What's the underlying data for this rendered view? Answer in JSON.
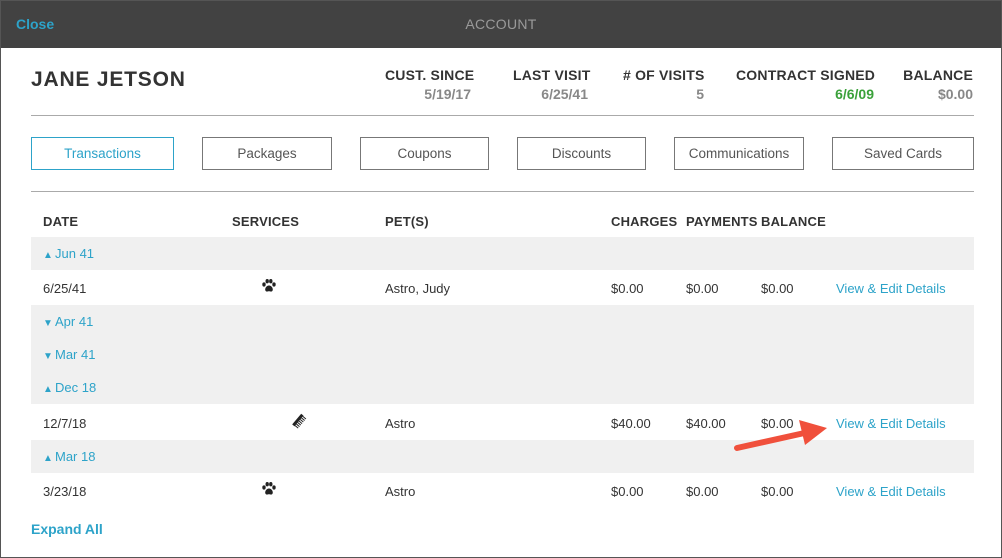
{
  "topbar": {
    "close_label": "Close",
    "title": "ACCOUNT"
  },
  "customer": {
    "name": "JANE JETSON",
    "stats": [
      {
        "label": "CUST. SINCE",
        "value": "5/19/17"
      },
      {
        "label": "LAST VISIT",
        "value": "6/25/41"
      },
      {
        "label": "# OF VISITS",
        "value": "5"
      },
      {
        "label": "CONTRACT SIGNED",
        "value": "6/6/09"
      },
      {
        "label": "BALANCE",
        "value": "$0.00"
      }
    ]
  },
  "tabs": [
    {
      "label": "Transactions",
      "active": true
    },
    {
      "label": "Packages"
    },
    {
      "label": "Coupons"
    },
    {
      "label": "Discounts"
    },
    {
      "label": "Communications"
    },
    {
      "label": "Saved Cards"
    }
  ],
  "table": {
    "headers": {
      "date": "DATE",
      "services": "SERVICES",
      "pets": "PET(S)",
      "charges": "CHARGES",
      "payments": "PAYMENTS",
      "balance": "BALANCE"
    },
    "groups": [
      {
        "label": "Jun 41",
        "chevron": "up"
      },
      {
        "label": "Apr 41",
        "chevron": "down"
      },
      {
        "label": "Mar 41",
        "chevron": "down"
      },
      {
        "label": "Dec 18",
        "chevron": "up"
      },
      {
        "label": "Mar 18",
        "chevron": "up"
      }
    ],
    "rows": [
      {
        "date": "6/25/41",
        "service_icon": "paw-icon",
        "pets": "Astro, Judy",
        "charges": "$0.00",
        "payments": "$0.00",
        "balance": "$0.00",
        "action": "View & Edit Details"
      },
      {
        "date": "12/7/18",
        "service_icon": "comb-icon",
        "pets": "Astro",
        "charges": "$40.00",
        "payments": "$40.00",
        "balance": "$0.00",
        "action": "View & Edit Details"
      },
      {
        "date": "3/23/18",
        "service_icon": "paw-icon",
        "pets": "Astro",
        "charges": "$0.00",
        "payments": "$0.00",
        "balance": "$0.00",
        "action": "View & Edit Details"
      }
    ]
  },
  "footer": {
    "expand_all_label": "Expand All"
  },
  "colors": {
    "accent": "#2da3c9",
    "topbar": "#424242",
    "group_bg": "#f0f0f0",
    "contract_green": "#3aa13a",
    "annotation_arrow": "#f0503c"
  }
}
